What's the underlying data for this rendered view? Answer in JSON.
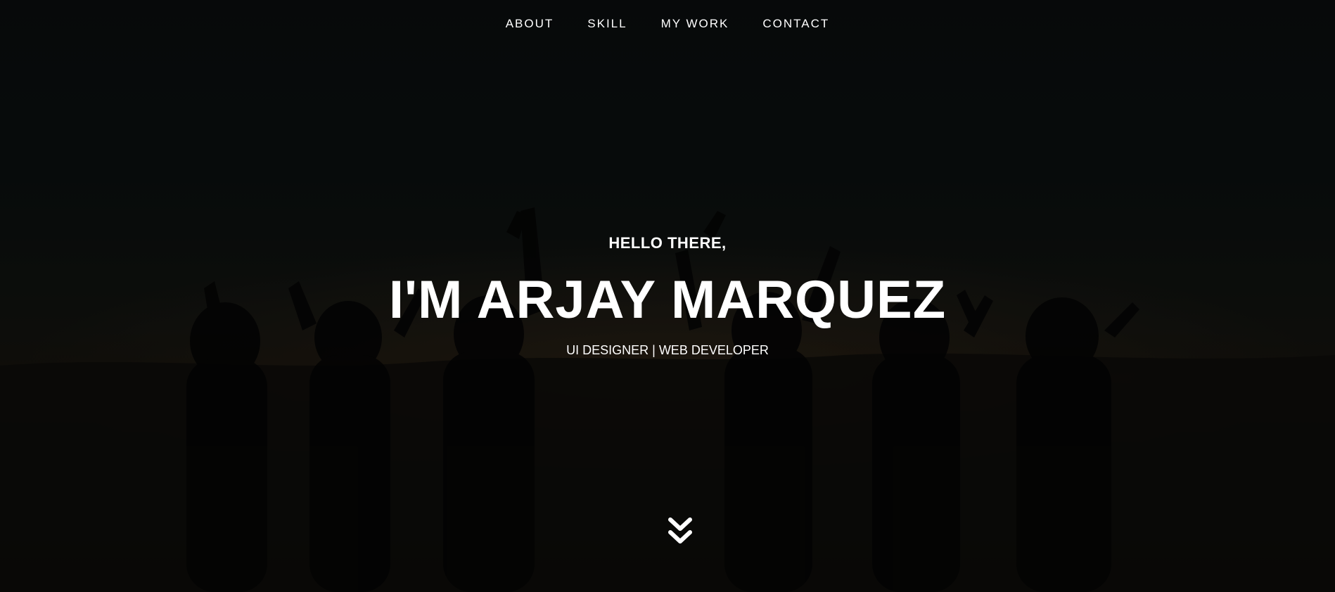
{
  "nav": {
    "items": [
      {
        "label": "ABOUT"
      },
      {
        "label": "SKILL"
      },
      {
        "label": "MY WORK"
      },
      {
        "label": "CONTACT"
      }
    ]
  },
  "hero": {
    "greeting": "HELLO THERE,",
    "name": "I'M ARJAY MARQUEZ",
    "subtitle": "UI DESIGNER | WEB DEVELOPER",
    "scroll_icon": "double-chevron-down-icon"
  },
  "colors": {
    "text": "#ffffff",
    "background": "#0a0c0d"
  }
}
